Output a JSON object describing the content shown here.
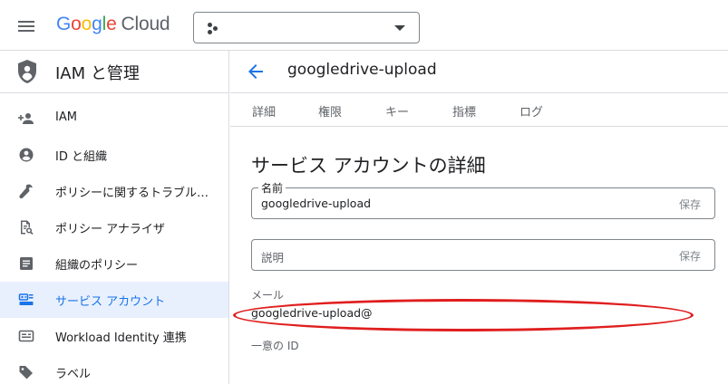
{
  "header": {
    "logo_google": "Google",
    "logo_cloud": "Cloud",
    "project_picker_value": ""
  },
  "sidebar": {
    "title": "IAM と管理",
    "items": [
      {
        "label": "IAM",
        "icon": "person-add-icon",
        "active": false
      },
      {
        "label": "ID と組織",
        "icon": "account-circle-icon",
        "active": false
      },
      {
        "label": "ポリシーに関するトラブル…",
        "icon": "wrench-icon",
        "active": false
      },
      {
        "label": "ポリシー アナライザ",
        "icon": "document-search-icon",
        "active": false
      },
      {
        "label": "組織のポリシー",
        "icon": "list-document-icon",
        "active": false
      },
      {
        "label": "サービス アカウント",
        "icon": "service-account-icon",
        "active": true
      },
      {
        "label": "Workload Identity 連携",
        "icon": "id-card-icon",
        "active": false
      },
      {
        "label": "ラベル",
        "icon": "label-tag-icon",
        "active": false
      }
    ]
  },
  "main": {
    "title": "googledrive-upload",
    "tabs": [
      "詳細",
      "権限",
      "キー",
      "指標",
      "ログ"
    ],
    "section_title": "サービス アカウントの詳細",
    "name_field": {
      "label": "名前",
      "value": "googledrive-upload",
      "save_label": "保存"
    },
    "description_field": {
      "placeholder": "説明",
      "save_label": "保存"
    },
    "email": {
      "label": "メール",
      "value": "googledrive-upload@"
    },
    "unique_id": {
      "label": "一意の ID"
    }
  },
  "colors": {
    "accent": "#1a73e8",
    "active_bg": "#e8f0fe",
    "annotation_red": "#e01e1e",
    "google_blue": "#4285f4",
    "google_red": "#ea4335",
    "google_yellow": "#fbbc05",
    "google_green": "#34a853"
  }
}
